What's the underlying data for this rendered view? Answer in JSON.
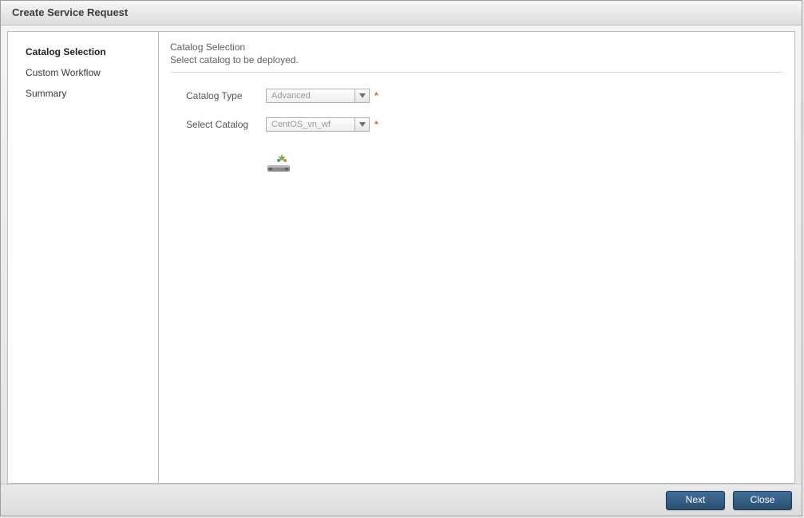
{
  "window": {
    "title": "Create Service Request"
  },
  "sidebar": {
    "items": [
      {
        "label": "Catalog Selection",
        "current": true
      },
      {
        "label": "Custom Workflow",
        "current": false
      },
      {
        "label": "Summary",
        "current": false
      }
    ]
  },
  "content": {
    "header": {
      "title": "Catalog Selection",
      "subtitle": "Select catalog to be deployed."
    },
    "form": {
      "catalog_type": {
        "label": "Catalog Type",
        "value": "Advanced",
        "required_marker": "*"
      },
      "select_catalog": {
        "label": "Select Catalog",
        "value": "CentOS_vn_wf",
        "required_marker": "*"
      }
    }
  },
  "footer": {
    "next_label": "Next",
    "close_label": "Close"
  }
}
